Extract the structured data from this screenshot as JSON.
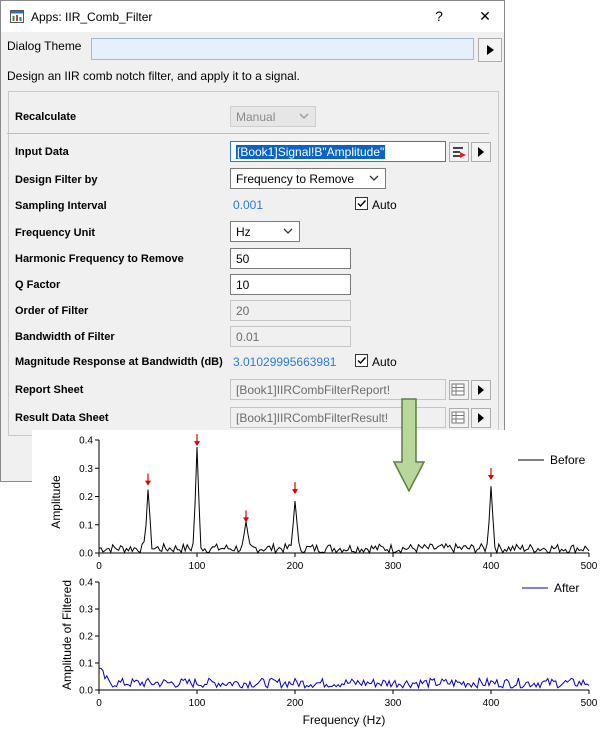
{
  "window": {
    "title": "Apps: IIR_Comb_Filter",
    "help_label": "?",
    "close_label": "✕"
  },
  "theme": {
    "label": "Dialog Theme",
    "value": ""
  },
  "description": "Design an IIR comb notch filter, and apply it to a signal.",
  "form": {
    "recalculate": {
      "label": "Recalculate",
      "value": "Manual"
    },
    "input_data": {
      "label": "Input Data",
      "value": "[Book1]Signal!B\"Amplitude\""
    },
    "design_filter_by": {
      "label": "Design Filter by",
      "value": "Frequency to Remove"
    },
    "sampling_interval": {
      "label": "Sampling Interval",
      "value": "0.001",
      "auto_label": "Auto",
      "auto_checked": true
    },
    "frequency_unit": {
      "label": "Frequency Unit",
      "value": "Hz"
    },
    "harmonic_frequency": {
      "label": "Harmonic Frequency to Remove",
      "value": "50"
    },
    "q_factor": {
      "label": "Q Factor",
      "value": "10"
    },
    "order_of_filter": {
      "label": "Order of Filter",
      "value": "20"
    },
    "bandwidth_of_filter": {
      "label": "Bandwidth of Filter",
      "value": "0.01"
    },
    "magnitude_response": {
      "label": "Magnitude Response at Bandwidth (dB)",
      "value": "3.01029995663981",
      "auto_label": "Auto",
      "auto_checked": true
    },
    "report_sheet": {
      "label": "Report Sheet",
      "value": "[Book1]IIRCombFilterReport!"
    },
    "result_data_sheet": {
      "label": "Result Data Sheet",
      "value": "[Book1]IIRCombFilterResult!"
    }
  },
  "colors": {
    "before_series": "#000000",
    "after_series": "#0000cc",
    "marker": "#e00000",
    "arrow_fill": "#b8d79a",
    "arrow_stroke": "#5f7f45",
    "link": "#2b7cd3"
  },
  "chart_data": [
    {
      "type": "line",
      "ylabel": "Amplitude",
      "xlim": [
        0,
        500
      ],
      "ylim": [
        0,
        0.4
      ],
      "xticks": [
        0,
        100,
        200,
        300,
        400,
        500
      ],
      "yticks": [
        0.0,
        0.1,
        0.2,
        0.3,
        0.4
      ],
      "xtick_labels": [
        "0",
        "100",
        "200",
        "300",
        "400",
        "500"
      ],
      "ytick_labels": [
        "0.0",
        "0.1",
        "0.2",
        "0.3",
        "0.4"
      ],
      "grid": false,
      "legend": "top-right",
      "series": [
        {
          "name": "Before",
          "noise_level": 0.015,
          "peaks": [
            {
              "x": 50,
              "y": 0.21
            },
            {
              "x": 100,
              "y": 0.35
            },
            {
              "x": 150,
              "y": 0.08
            },
            {
              "x": 200,
              "y": 0.18
            },
            {
              "x": 400,
              "y": 0.23
            }
          ]
        }
      ],
      "markers": [
        50,
        100,
        150,
        200,
        400
      ]
    },
    {
      "type": "line",
      "xlabel": "Frequency (Hz)",
      "ylabel": "Amplitude of Filtered",
      "xlim": [
        0,
        500
      ],
      "ylim": [
        0,
        0.4
      ],
      "xticks": [
        0,
        100,
        200,
        300,
        400,
        500
      ],
      "yticks": [
        0.0,
        0.1,
        0.2,
        0.3,
        0.4
      ],
      "xtick_labels": [
        "0",
        "100",
        "200",
        "300",
        "400",
        "500"
      ],
      "ytick_labels": [
        "0.0",
        "0.1",
        "0.2",
        "0.3",
        "0.4"
      ],
      "grid": false,
      "legend": "top-right",
      "series": [
        {
          "name": "After",
          "noise_level": 0.02
        }
      ]
    }
  ]
}
